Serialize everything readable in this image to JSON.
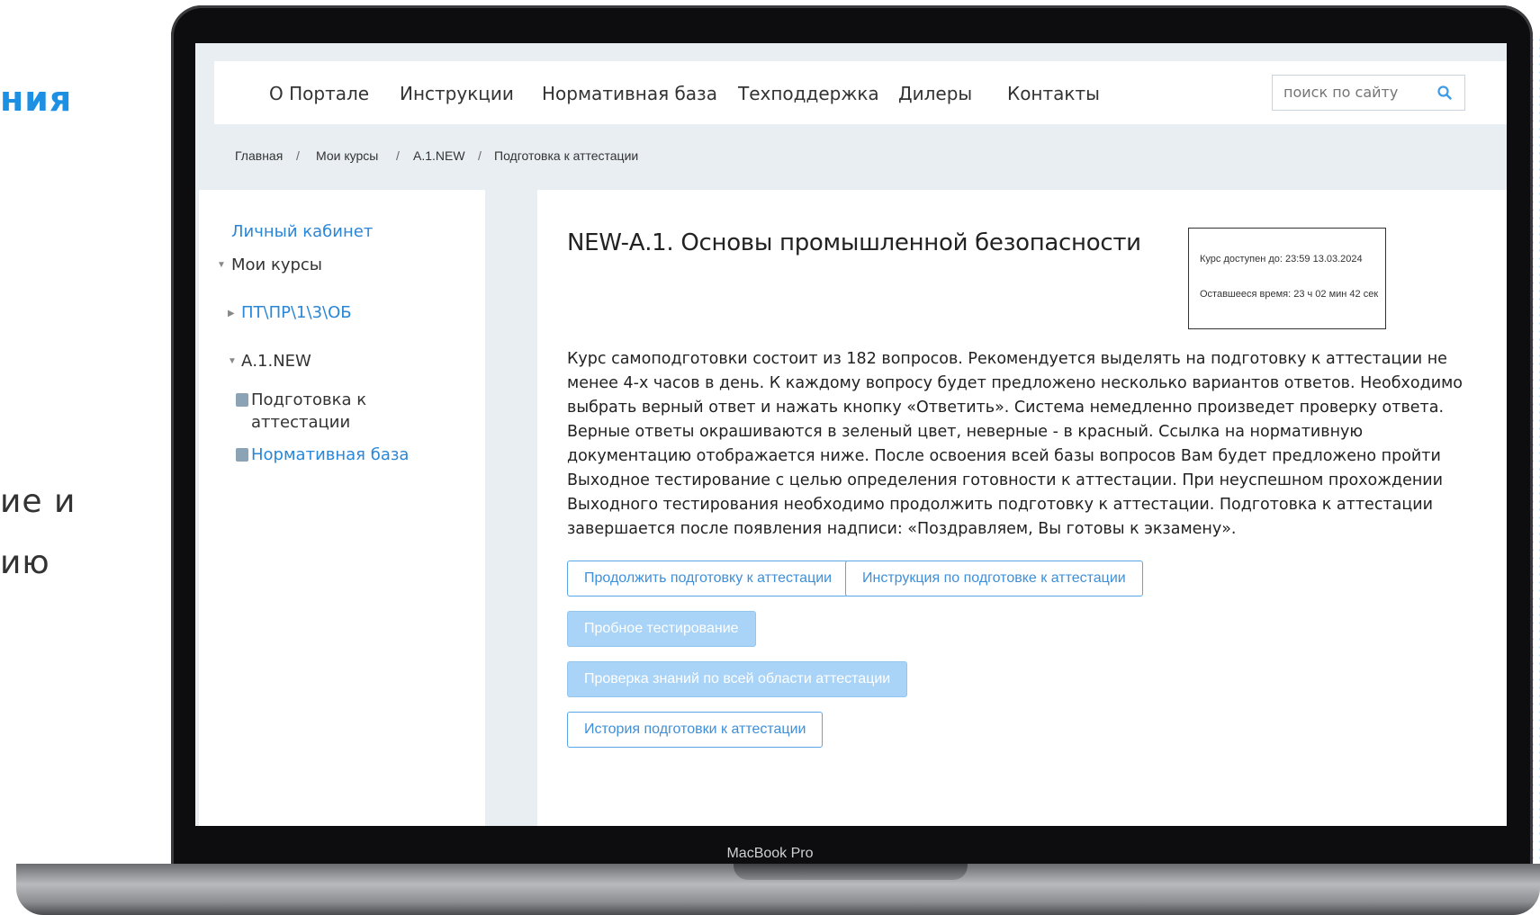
{
  "slide": {
    "heading_fragment": "ния",
    "line1_fragment": "ие и",
    "line2_fragment": "ию"
  },
  "device": {
    "label": "MacBook Pro"
  },
  "nav": {
    "items": [
      "О Портале",
      "Инструкции",
      "Нормативная база",
      "Техподдержка",
      "Дилеры",
      "Контакты"
    ],
    "search_placeholder": "поиск по сайту"
  },
  "breadcrumb": {
    "items": [
      "Главная",
      "Мои курсы",
      "А.1.NEW",
      "Подготовка к аттестации"
    ],
    "separator": "/"
  },
  "sidebar": {
    "cabinet": "Личный кабинет",
    "my_courses": "Мои курсы",
    "course1": "ПТ\\ПР\\1\\3\\ОБ",
    "course2": "А.1.NEW",
    "prep_line1": "Подготовка к",
    "prep_line2": "аттестации",
    "normative": "Нормативная база"
  },
  "content": {
    "title": "NEW-А.1. Основы промышленной безопасности",
    "available_until": "Курс доступен до: 23:59 13.03.2024",
    "remaining": "Оставшееся время: 23 ч 02 мин 42 сек",
    "description": [
      "Курс самоподготовки состоит из 182 вопросов. Рекомендуется выделять на подготовку к аттестации не",
      "менее 4-х часов в день. К каждому вопросу будет предложено несколько вариантов ответов. Необходимо",
      "выбрать верный ответ и нажать кнопку «Ответить». Система немедленно произведет проверку ответа.",
      "Верные ответы окрашиваются в зеленый цвет, неверные - в красный. Ссылка на нормативную",
      "документацию отображается ниже. После освоения всей базы вопросов Вам будет предложено пройти",
      "Выходное тестирование с целью определения готовности к аттестации. При неуспешном прохождении",
      "Выходного тестирования необходимо продолжить подготовку к аттестации. Подготовка к аттестации",
      "завершается после появления надписи: «Поздравляем, Вы готовы к экзамену»."
    ],
    "buttons": {
      "continue": "Продолжить подготовку к аттестации",
      "instruction": "Инструкция по подготовке к аттестации",
      "trial": "Пробное тестирование",
      "check": "Проверка знаний по всей области аттестации",
      "history": "История подготовки к аттестации"
    }
  },
  "colors": {
    "accent": "#2a86d6",
    "button_border": "#5aa7e8",
    "button_disabled": "#a9d4f7",
    "page_bg": "#e9eef3"
  }
}
